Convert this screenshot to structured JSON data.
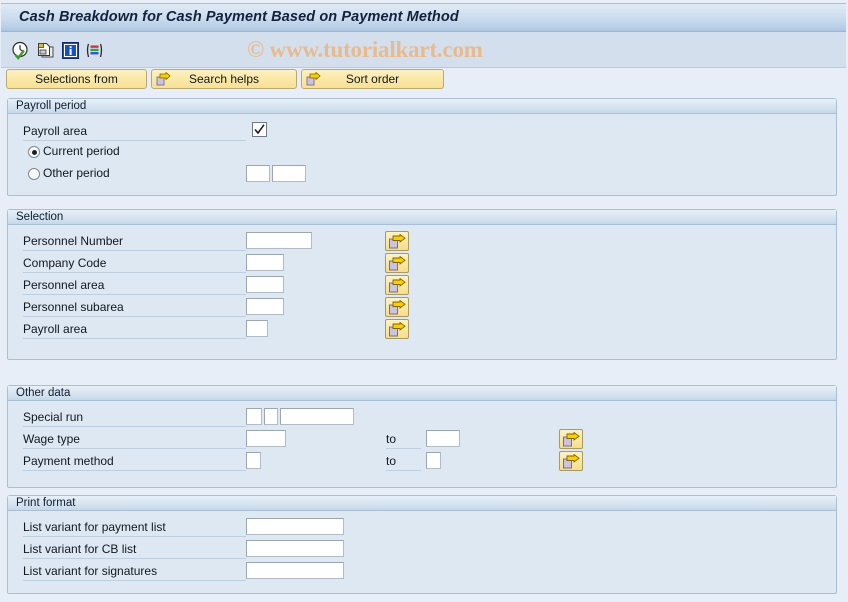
{
  "window": {
    "title": "Cash Breakdown for Cash Payment Based on Payment Method"
  },
  "watermark": {
    "text": "© www.tutorialkart.com",
    "color": "#eab98c"
  },
  "toolbar": {
    "icons": [
      {
        "name": "execute-clock-icon",
        "title": "Execute"
      },
      {
        "name": "multiple-selection-icon",
        "title": "Multiple selection"
      },
      {
        "name": "information-icon",
        "title": "Information"
      },
      {
        "name": "layout-variant-icon",
        "title": "Display variant"
      }
    ]
  },
  "buttons": {
    "selections_from": "Selections from",
    "search_helps": "Search helps",
    "sort_order": "Sort order"
  },
  "groups": {
    "payroll_period": {
      "title": "Payroll period",
      "payroll_area_label": "Payroll area",
      "payroll_area_checked": true,
      "current_period_label": "Current period",
      "other_period_label": "Other period",
      "selected_radio": "current_period",
      "other_period_value_1": "",
      "other_period_value_2": ""
    },
    "selection": {
      "title": "Selection",
      "rows": [
        {
          "label": "Personnel Number",
          "value": "",
          "field_width": 66,
          "has_arrow": true
        },
        {
          "label": "Company Code",
          "value": "",
          "field_width": 38,
          "has_arrow": true
        },
        {
          "label": "Personnel area",
          "value": "",
          "field_width": 38,
          "has_arrow": true
        },
        {
          "label": "Personnel subarea",
          "value": "",
          "field_width": 38,
          "has_arrow": true
        },
        {
          "label": "Payroll area",
          "value": "",
          "field_width": 22,
          "has_arrow": true
        }
      ]
    },
    "other_data": {
      "title": "Other data",
      "special_run_label": "Special run",
      "special_run_value_1": "",
      "special_run_value_2": "",
      "special_run_value_3": "",
      "wage_type_label": "Wage type",
      "wage_type_from": "",
      "wage_type_to": "",
      "payment_method_label": "Payment method",
      "payment_method_from": "",
      "payment_method_to": "",
      "to_label": "to"
    },
    "print_format": {
      "title": "Print format",
      "rows": [
        {
          "label": "List variant for payment list",
          "value": ""
        },
        {
          "label": "List variant for CB list",
          "value": ""
        },
        {
          "label": "List variant for signatures",
          "value": ""
        }
      ]
    }
  }
}
